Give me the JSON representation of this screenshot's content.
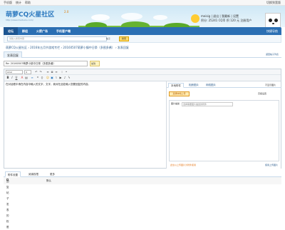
{
  "topbar": {
    "links": [
      "手机版",
      "统计",
      "帮助"
    ],
    "right": "切换到宽版"
  },
  "header": {
    "logo": "萌萝CQ火星社区",
    "version": "2.0",
    "url": "http://www.meituxiu.com/",
    "user": {
      "name": "meisig",
      "menu": [
        "退出",
        "我最新",
        "设置"
      ],
      "score": "积分: 25241 CQ币",
      "level": "积 120 元",
      "extra": "注册用户"
    }
  },
  "nav": {
    "items": [
      "论坛",
      "群组",
      "火箭广场",
      "手机客户端"
    ],
    "active": 0,
    "right": "快捷导航"
  },
  "search": {
    "placeholder": "请输入搜索内容",
    "type": "帖子",
    "button": "搜索"
  },
  "breadcrumb": "萌萝CQ火星社区 › 2016年五月节游戏专栏 › 20160507萌萝小镇中日祭（多图多酱） › 发表回复",
  "page_tab": {
    "label": "发表回复",
    "back": "返回帖子列表"
  },
  "post": {
    "title": "Re: 20160507萌萝小镇中日祭（多图多酱）",
    "title_sel": "加到"
  },
  "editor": {
    "font": "Arial",
    "size": "4",
    "body": "在对话框中请在内容中输入的文字，文字，我对在此处输入您要回复的内容。"
  },
  "side": {
    "tabs": [
      "本地附件",
      "相册图片",
      "网络图片"
    ],
    "active": 0,
    "mode": "不显示图片",
    "upload_btn": "选择本地上传",
    "upload_opt": "高级设置",
    "list_label": "图片描述",
    "list_desc": "选择需要图片描述的附件",
    "foot_left": "此处以上传图片为附件使用",
    "foot_right": "使用上传图片"
  },
  "bottom": {
    "tabs": [
      "附件设置",
      "阅读权限",
      "更多"
    ],
    "active": 0,
    "perm_left": "回复帖子发表的权限",
    "perm_right": "默认"
  }
}
